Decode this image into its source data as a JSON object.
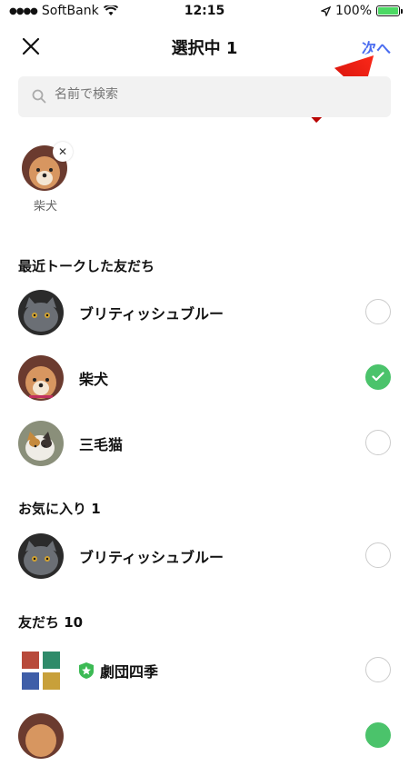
{
  "status_bar": {
    "carrier": "SoftBank",
    "time": "12:15",
    "battery": "100%"
  },
  "header": {
    "title": "選択中 1",
    "next_label": "次へ"
  },
  "search": {
    "placeholder": "名前で検索"
  },
  "selected": [
    {
      "name": "柴犬"
    }
  ],
  "sections": {
    "recent": {
      "title": "最近トークした友だち",
      "items": [
        {
          "name": "ブリティッシュブルー",
          "checked": false
        },
        {
          "name": "柴犬",
          "checked": true
        },
        {
          "name": "三毛猫",
          "checked": false
        }
      ]
    },
    "favorites": {
      "title": "お気に入り 1",
      "items": [
        {
          "name": "ブリティッシュブルー",
          "checked": false
        }
      ]
    },
    "friends": {
      "title": "友だち 10",
      "items": [
        {
          "name": "劇団四季",
          "checked": false,
          "logo_text": "劇団四季"
        }
      ]
    }
  },
  "colors": {
    "accent": "#4a6cf0",
    "check": "#4bc36b",
    "arrow": "#e8130e"
  },
  "icons": [
    "wifi-icon",
    "location-icon",
    "battery-icon",
    "close-icon",
    "search-icon",
    "checkmark-icon",
    "verified-badge-icon",
    "arrow-annotation"
  ]
}
